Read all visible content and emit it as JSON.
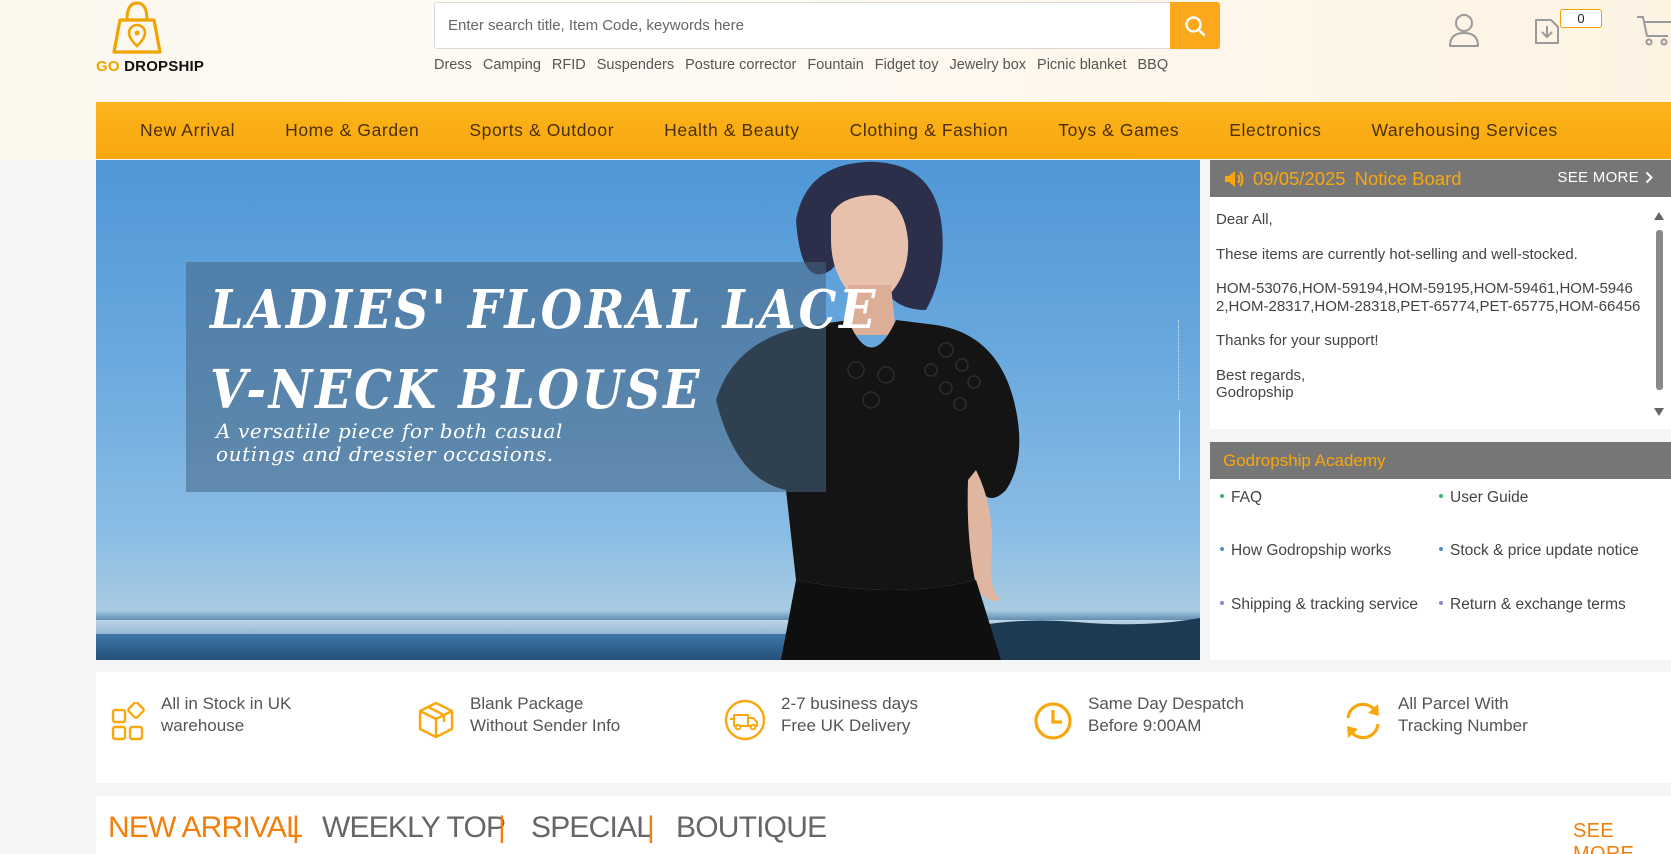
{
  "brand": {
    "go": "GO",
    "dropship": "DROPSHIP"
  },
  "search": {
    "placeholder": "Enter search title, Item Code, keywords here",
    "value": ""
  },
  "hot_words": [
    "Dress",
    "Camping",
    "RFID",
    "Suspenders",
    "Posture corrector",
    "Fountain",
    "Fidget toy",
    "Jewelry box",
    "Picnic blanket",
    "BBQ"
  ],
  "header": {
    "cart_count": "0"
  },
  "nav": [
    "New Arrival",
    "Home & Garden",
    "Sports & Outdoor",
    "Health & Beauty",
    "Clothing & Fashion",
    "Toys & Games",
    "Electronics",
    "Warehousing Services"
  ],
  "banner": {
    "title_line1": "LADIES' FLORAL LACE",
    "title_line2": "V-NECK BLOUSE",
    "subtitle_line1": "A versatile piece for both casual",
    "subtitle_line2": "outings and dressier occasions."
  },
  "notice": {
    "date": "09/05/2025",
    "title": "Notice Board",
    "see_more": "SEE MORE",
    "greeting": "Dear All,",
    "line1": "These items are currently hot-selling and well-stocked.",
    "codes": "HOM-53076,HOM-59194,HOM-59195,HOM-59461,HOM-59462,HOM-28317,HOM-28318,PET-65774,PET-65775,HOM-66456",
    "thanks": "Thanks for your support!",
    "regards": "Best regards,",
    "signature": "Godropship"
  },
  "academy": {
    "title": "Godropship Academy",
    "links": [
      "FAQ",
      "User Guide",
      "How Godropship works",
      "Stock & price update notice",
      "Shipping & tracking service",
      "Return & exchange terms"
    ]
  },
  "features": [
    {
      "line1": "All in Stock in UK",
      "line2": "warehouse",
      "icon": "grid-icon"
    },
    {
      "line1": "Blank Package",
      "line2": "Without Sender Info",
      "icon": "package-icon"
    },
    {
      "line1": "2-7 business days",
      "line2": "Free UK Delivery",
      "icon": "truck-icon"
    },
    {
      "line1": "Same Day Despatch",
      "line2": "Before 9:00AM",
      "icon": "clock-icon"
    },
    {
      "line1": "All Parcel With",
      "line2": "Tracking Number",
      "icon": "refresh-icon"
    }
  ],
  "tabs": {
    "items": [
      "NEW ARRIVAL",
      "WEEKLY TOP",
      "SPECIAL",
      "BOUTIQUE"
    ],
    "separator": "|",
    "see_more": "SEE MORE"
  },
  "colors": {
    "accent": "#f9a70e",
    "tab_active": "#f37f0b",
    "panel_head": "#767676"
  }
}
